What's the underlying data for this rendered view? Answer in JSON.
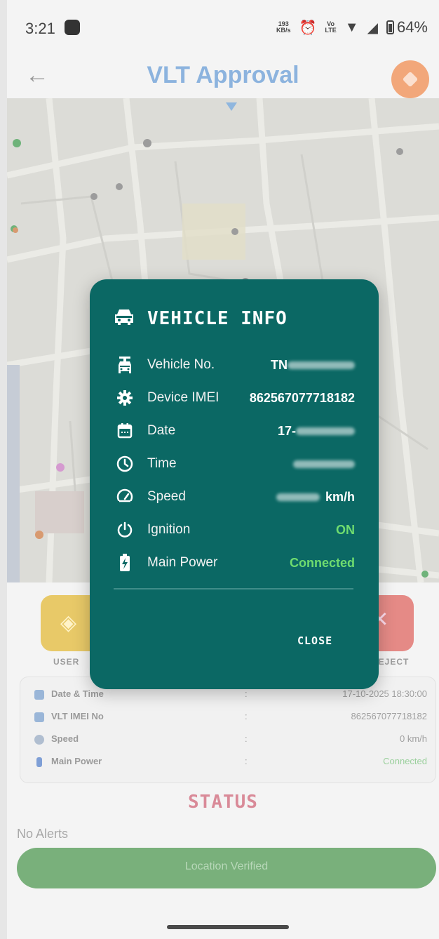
{
  "status_bar": {
    "time": "3:21",
    "net_speed_top": "193",
    "net_speed_bottom": "KB/s",
    "volte_top": "Vo",
    "volte_bottom": "LTE",
    "battery": "64%"
  },
  "header": {
    "title": "VLT Approval",
    "back_icon": "arrow-left-icon"
  },
  "actions": {
    "left_label": "USER",
    "right_label": "REJECT"
  },
  "details": {
    "rows": [
      {
        "label": "Date & Time",
        "colon": ":",
        "value": "17-10-2025 18:30:00"
      },
      {
        "label": "VLT IMEI No",
        "colon": ":",
        "value": "862567077718182"
      },
      {
        "label": "Speed",
        "colon": ":",
        "value": "0 km/h"
      },
      {
        "label": "Main Power",
        "colon": ":",
        "value": "Connected"
      }
    ]
  },
  "status": {
    "title": "STATUS",
    "no_alerts": "No Alerts",
    "verified": "Location Verified"
  },
  "modal": {
    "title": "VEHICLE INFO",
    "rows": [
      {
        "icon": "vehicle-number-icon",
        "label": "Vehicle No.",
        "value": "TN"
      },
      {
        "icon": "gear-icon",
        "label": "Device IMEI",
        "value": "862567077718182"
      },
      {
        "icon": "calendar-icon",
        "label": "Date",
        "value": "17-"
      },
      {
        "icon": "clock-icon",
        "label": "Time",
        "value": ""
      },
      {
        "icon": "speedometer-icon",
        "label": "Speed",
        "value": "km/h"
      },
      {
        "icon": "power-icon",
        "label": "Ignition",
        "value": "ON"
      },
      {
        "icon": "battery-charging-icon",
        "label": "Main Power",
        "value": "Connected"
      }
    ],
    "close_label": "CLOSE"
  },
  "colors": {
    "modal_bg": "#0b6864",
    "accent_green": "#6fdc6f",
    "title_blue": "#8cb3de",
    "status_red": "#d98a98"
  }
}
